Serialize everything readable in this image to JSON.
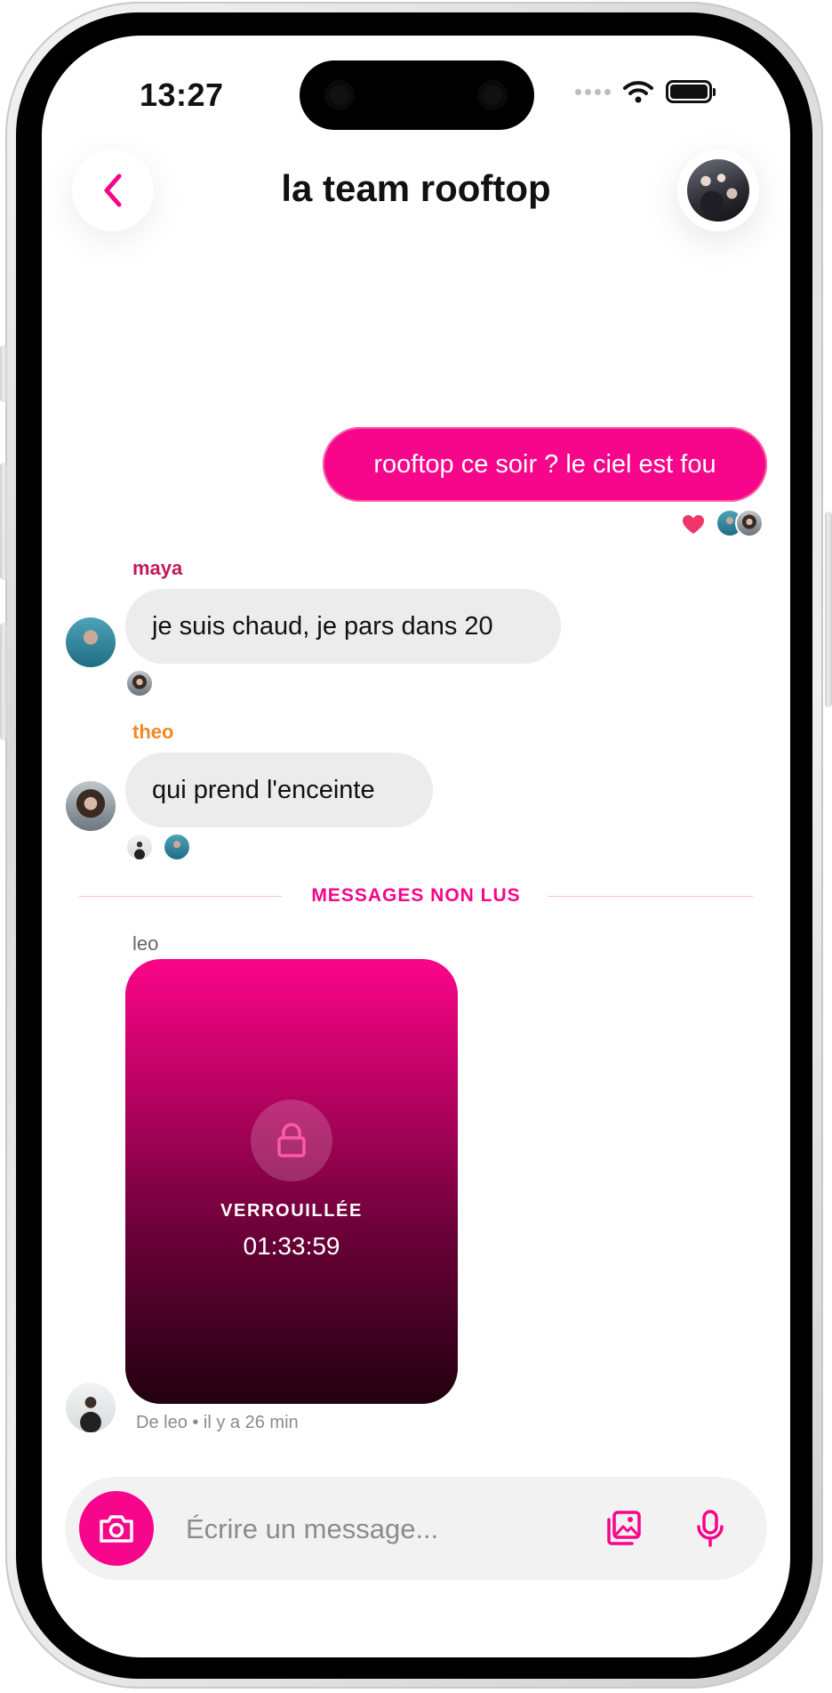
{
  "status_bar": {
    "time": "13:27"
  },
  "header": {
    "title": "la team rooftop",
    "back_icon": "chevron-left-icon"
  },
  "colors": {
    "accent": "#f7058a",
    "maya": "#c2185b",
    "theo": "#f08a24",
    "bubble_in": "#ececec"
  },
  "messages": {
    "outgoing": {
      "text": "rooftop ce soir ? le ciel est fou",
      "reaction": "heart-icon"
    },
    "maya": {
      "sender": "maya",
      "text": "je suis chaud, je pars dans 20"
    },
    "theo": {
      "sender": "theo",
      "text": "qui prend l'enceinte"
    },
    "unread_divider": "MESSAGES NON LUS",
    "leo": {
      "sender": "leo",
      "locked_label": "VERROUILLÉE",
      "timer": "01:33:59",
      "meta": "De leo • il y a 26 min"
    }
  },
  "composer": {
    "placeholder": "Écrire un message...",
    "camera_icon": "camera-icon",
    "gallery_icon": "gallery-icon",
    "mic_icon": "microphone-icon"
  }
}
